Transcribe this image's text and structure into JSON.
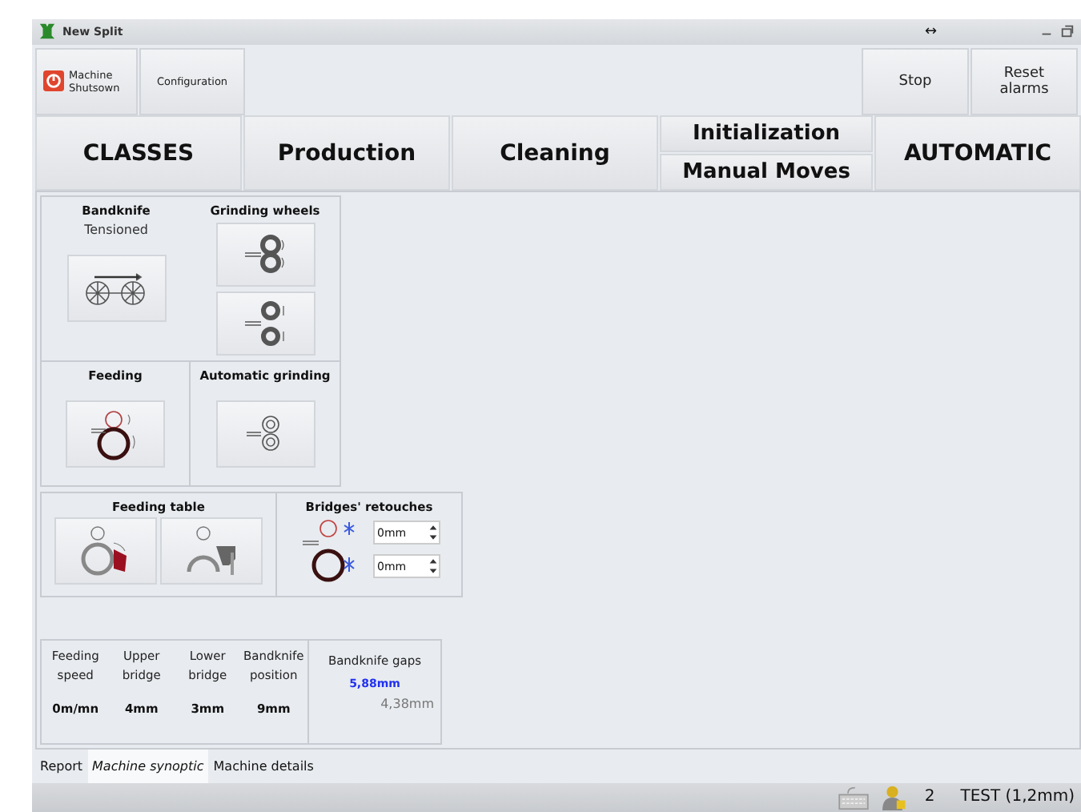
{
  "window": {
    "title": "New Split",
    "resize_glyph": "↔"
  },
  "toolbar": {
    "left": [
      {
        "label": "Machine Shutsown",
        "kind": "power"
      },
      {
        "label": "Configuration",
        "kind": "plain"
      }
    ],
    "right": [
      {
        "label": "Stop"
      },
      {
        "label": "Reset alarms"
      }
    ]
  },
  "nav": [
    {
      "kind": "single",
      "label": "CLASSES"
    },
    {
      "kind": "single",
      "label": "Production"
    },
    {
      "kind": "single",
      "label": "Cleaning"
    },
    {
      "kind": "stack",
      "labels": [
        "Initialization",
        "Manual Moves"
      ]
    },
    {
      "kind": "single",
      "label": "AUTOMATIC"
    }
  ],
  "bandknife": {
    "title": "Bandknife",
    "status": "Tensioned"
  },
  "grinding_wheels": {
    "title": "Grinding wheels"
  },
  "feeding": {
    "title": "Feeding"
  },
  "automatic_grinding": {
    "title": "Automatic grinding"
  },
  "feeding_table": {
    "title": "Feeding table"
  },
  "bridges_retouches": {
    "title": "Bridges' retouches",
    "fields": [
      {
        "value": "0mm"
      },
      {
        "value": "0mm"
      }
    ]
  },
  "readings": [
    {
      "label": "Feeding speed",
      "value": "0m/mn"
    },
    {
      "label": "Upper bridge",
      "value": "4mm"
    },
    {
      "label": "Lower bridge",
      "value": "3mm"
    },
    {
      "label": "Bandknife position",
      "value": "9mm"
    }
  ],
  "gaps": {
    "title": "Bandknife gaps",
    "primary": "5,88mm",
    "secondary": "4,38mm"
  },
  "bottom_tabs": [
    {
      "label": "Report",
      "selected": false
    },
    {
      "label": "Machine synoptic",
      "selected": true
    },
    {
      "label": "Machine details",
      "selected": false
    }
  ],
  "status_bar": {
    "count": "2",
    "mode": "TEST (1,2mm)"
  }
}
